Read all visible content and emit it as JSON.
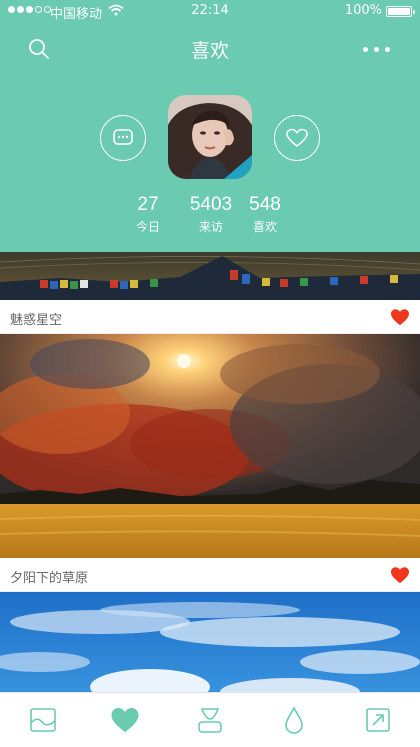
{
  "status_bar": {
    "carrier": "中国移动",
    "time": "22:14",
    "battery": "100%",
    "signal_icon": "signal-dots-icon",
    "wifi_icon": "wifi-icon",
    "battery_icon": "battery-icon",
    "battery_level": 1.0
  },
  "nav": {
    "title": "喜欢",
    "search_icon": "search-icon",
    "more_icon": "more-dots-icon"
  },
  "profile": {
    "chat_icon": "chat-bubble-icon",
    "like_icon": "heart-outline-icon",
    "stats": [
      {
        "value": "27",
        "label": "今日"
      },
      {
        "value": "5403",
        "label": "来访"
      },
      {
        "value": "548",
        "label": "喜欢"
      }
    ]
  },
  "feed": {
    "items": [
      {
        "caption": "魅惑星空",
        "liked": true
      },
      {
        "caption": "夕阳下的草原",
        "liked": true
      },
      {
        "caption": "",
        "liked": false
      }
    ]
  },
  "tabbar": {
    "tabs": [
      {
        "icon": "picture-icon",
        "active": false
      },
      {
        "icon": "heart-icon",
        "active": true
      },
      {
        "icon": "person-icon",
        "active": false
      },
      {
        "icon": "drop-icon",
        "active": false
      },
      {
        "icon": "share-icon",
        "active": false
      }
    ]
  },
  "colors": {
    "accent": "#6acbb1",
    "heart_red": "#f2361d",
    "caption_text": "#666666"
  }
}
